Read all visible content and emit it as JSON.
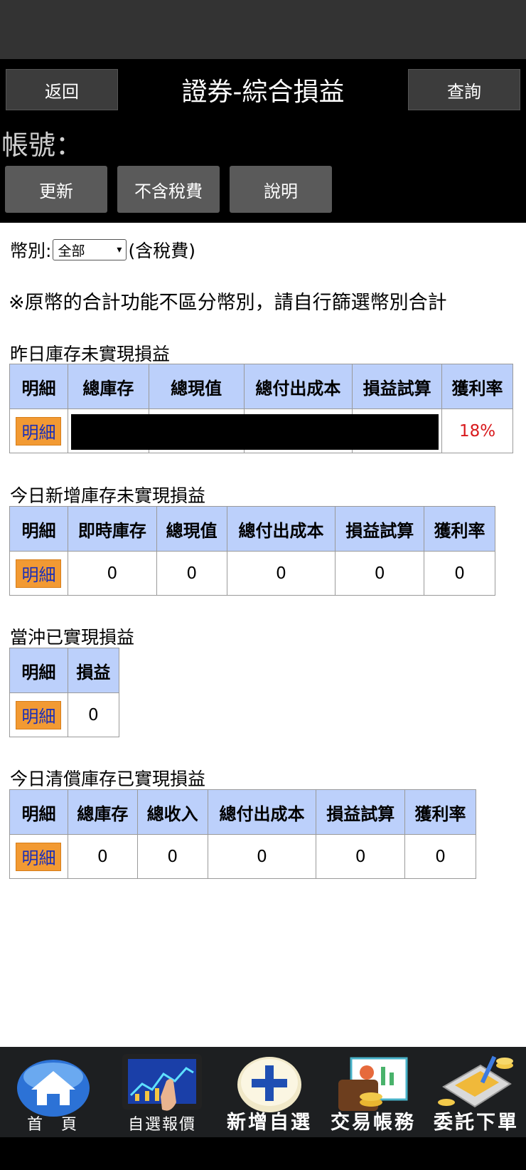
{
  "header": {
    "back_label": "返回",
    "title": "證券-綜合損益",
    "query_label": "查詢",
    "account_label": "帳號：",
    "buttons": {
      "refresh": "更新",
      "tax": "不含稅費",
      "help": "說明"
    }
  },
  "filter": {
    "currency_label": "幣別:",
    "currency_value": "全部",
    "tax_suffix": "(含稅費)",
    "note": "※原幣的合計功能不區分幣別，請自行篩選幣別合計"
  },
  "sections": {
    "yesterday": {
      "title": "昨日庫存未實現損益",
      "headers": [
        "明細",
        "總庫存",
        "總現值",
        "總付出成本",
        "損益試算",
        "獲利率"
      ],
      "detail_label": "明細",
      "profit_rate": "18%"
    },
    "today_new": {
      "title": "今日新增庫存未實現損益",
      "headers": [
        "明細",
        "即時庫存",
        "總現值",
        "總付出成本",
        "損益試算",
        "獲利率"
      ],
      "detail_label": "明細",
      "values": [
        "0",
        "0",
        "0",
        "0",
        "0"
      ]
    },
    "daytrade": {
      "title": "當沖已實現損益",
      "headers": [
        "明細",
        "損益"
      ],
      "detail_label": "明細",
      "values": [
        "0"
      ]
    },
    "liquidated": {
      "title": "今日清償庫存已實現損益",
      "headers": [
        "明細",
        "總庫存",
        "總收入",
        "總付出成本",
        "損益試算",
        "獲利率"
      ],
      "detail_label": "明細",
      "values": [
        "0",
        "0",
        "0",
        "0",
        "0"
      ]
    }
  },
  "bottom_nav": [
    {
      "label": "首　頁",
      "icon": "home-icon"
    },
    {
      "label": "自選報價",
      "icon": "tablet-chart-icon"
    },
    {
      "label": "新增自選",
      "icon": "plus-icon"
    },
    {
      "label": "交易帳務",
      "icon": "wallet-icon"
    },
    {
      "label": "委託下單",
      "icon": "trading-device-icon"
    }
  ],
  "colors": {
    "header_bg": "#000000",
    "table_header": "#bcd0fb",
    "detail_button": "#f29a33",
    "profit_red": "#d8191c"
  }
}
